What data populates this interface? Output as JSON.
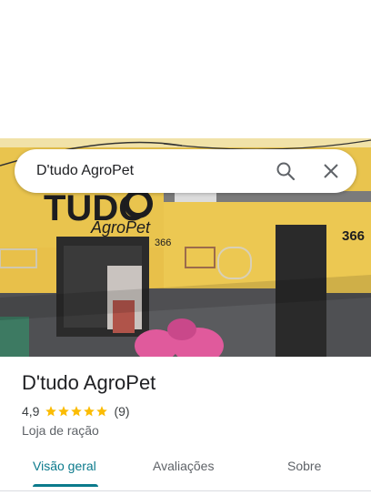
{
  "search": {
    "query": "D'tudo AgroPet"
  },
  "photo": {
    "sign_big": "TUDO",
    "sign_small": "AgroPet",
    "number_left": "366",
    "number_right": "366"
  },
  "place": {
    "name": "D'tudo AgroPet",
    "rating": "4,9",
    "stars": 5,
    "review_count": "(9)",
    "category": "Loja de ração"
  },
  "tabs": [
    {
      "label": "Visão geral",
      "active": true
    },
    {
      "label": "Avaliações",
      "active": false
    },
    {
      "label": "Sobre",
      "active": false
    }
  ],
  "colors": {
    "accent": "#0b7a8c",
    "star": "#fbbc04",
    "wall": "#e8c04a"
  }
}
